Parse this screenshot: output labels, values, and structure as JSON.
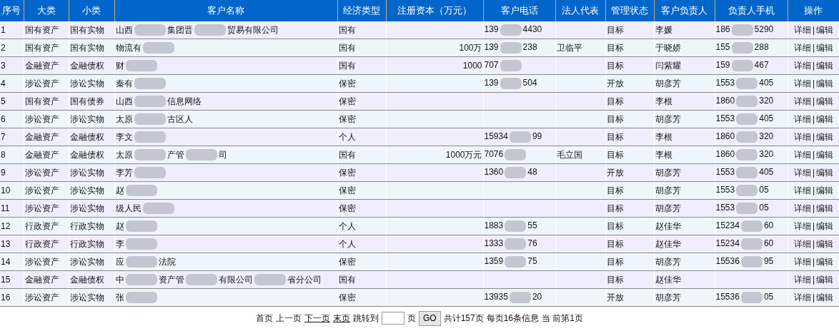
{
  "table": {
    "columns": [
      "序号",
      "大类",
      "小类",
      "客户名称",
      "经济类型",
      "注册资本（万元）",
      "客户电话",
      "法人代表",
      "管理状态",
      "客户负责人",
      "负责人手机",
      "操作"
    ],
    "rows": [
      {
        "no": "1",
        "category": "国有资产",
        "subcategory": "国有实物",
        "name": [
          "山西",
          "集团晋",
          "贸易有限公司"
        ],
        "economy": "国有",
        "capital": "",
        "phone": [
          "139",
          "4430"
        ],
        "legal": "",
        "status": "目标",
        "manager": "李媛",
        "manager_phone": [
          "186",
          "5290"
        ],
        "actions": [
          "详细",
          "|",
          "编辑"
        ]
      },
      {
        "no": "2",
        "category": "国有资产",
        "subcategory": "国有实物",
        "name": [
          "物流有"
        ],
        "economy": "国有",
        "capital": "100万",
        "phone": [
          "139",
          "238"
        ],
        "legal": "卫临平",
        "status": "目标",
        "manager": "于晓娇",
        "manager_phone": [
          "155",
          "288"
        ],
        "actions": [
          "详细",
          "|",
          "编辑"
        ]
      },
      {
        "no": "3",
        "category": "金融资产",
        "subcategory": "金融债权",
        "name": [
          "财"
        ],
        "economy": "国有",
        "capital": "1000",
        "phone": [
          "707"
        ],
        "legal": "",
        "status": "目标",
        "manager": "闫紫耀",
        "manager_phone": [
          "159",
          "467"
        ],
        "actions": [
          "详细",
          "|",
          "编辑"
        ]
      },
      {
        "no": "4",
        "category": "涉讼资产",
        "subcategory": "涉讼实物",
        "name": [
          "秦有"
        ],
        "economy": "保密",
        "capital": "",
        "phone": [
          "139",
          "504"
        ],
        "legal": "",
        "status": "开放",
        "manager": "胡彦芳",
        "manager_phone": [
          "1553",
          "405"
        ],
        "actions": [
          "详细",
          "|",
          "编辑"
        ]
      },
      {
        "no": "5",
        "category": "国有资产",
        "subcategory": "国有债券",
        "name": [
          "山西",
          "信息网络"
        ],
        "economy": "保密",
        "capital": "",
        "phone": [],
        "legal": "",
        "status": "目标",
        "manager": "李根",
        "manager_phone": [
          "1860",
          "320"
        ],
        "actions": [
          "详细",
          "|",
          "编辑"
        ]
      },
      {
        "no": "6",
        "category": "涉讼资产",
        "subcategory": "涉讼实物",
        "name": [
          "太原",
          "古区人"
        ],
        "economy": "保密",
        "capital": "",
        "phone": [],
        "legal": "",
        "status": "目标",
        "manager": "胡彦芳",
        "manager_phone": [
          "1553",
          "405"
        ],
        "actions": [
          "详细",
          "|",
          "编辑"
        ]
      },
      {
        "no": "7",
        "category": "金融资产",
        "subcategory": "金融债权",
        "name": [
          "李文"
        ],
        "economy": "个人",
        "capital": "",
        "phone": [
          "15934",
          "99"
        ],
        "legal": "",
        "status": "目标",
        "manager": "李根",
        "manager_phone": [
          "1860",
          "320"
        ],
        "actions": [
          "详细",
          "|",
          "编辑"
        ]
      },
      {
        "no": "8",
        "category": "金融资产",
        "subcategory": "金融债权",
        "name": [
          "太原",
          "产管",
          "司"
        ],
        "economy": "国有",
        "capital": "1000万元",
        "phone": [
          "7076"
        ],
        "legal": "毛立国",
        "status": "目标",
        "manager": "李根",
        "manager_phone": [
          "1860",
          "320"
        ],
        "actions": [
          "详细",
          "|",
          "编辑"
        ]
      },
      {
        "no": "9",
        "category": "涉讼资产",
        "subcategory": "涉讼实物",
        "name": [
          "李芳"
        ],
        "economy": "保密",
        "capital": "",
        "phone": [
          "1360",
          "48"
        ],
        "legal": "",
        "status": "开放",
        "manager": "胡彦芳",
        "manager_phone": [
          "1553",
          "405"
        ],
        "actions": [
          "详细",
          "|",
          "编辑"
        ]
      },
      {
        "no": "10",
        "category": "涉讼资产",
        "subcategory": "涉讼实物",
        "name": [
          "赵"
        ],
        "economy": "保密",
        "capital": "",
        "phone": [],
        "legal": "",
        "status": "目标",
        "manager": "胡彦芳",
        "manager_phone": [
          "1553",
          "05"
        ],
        "actions": [
          "详细",
          "|",
          "编辑"
        ]
      },
      {
        "no": "11",
        "category": "涉讼资产",
        "subcategory": "涉讼实物",
        "name": [
          "级人民"
        ],
        "economy": "保密",
        "capital": "",
        "phone": [],
        "legal": "",
        "status": "目标",
        "manager": "胡彦芳",
        "manager_phone": [
          "1553",
          "05"
        ],
        "actions": [
          "详细",
          "|",
          "编辑"
        ]
      },
      {
        "no": "12",
        "category": "行政资产",
        "subcategory": "行政实物",
        "name": [
          "赵"
        ],
        "economy": "个人",
        "capital": "",
        "phone": [
          "1883",
          "55"
        ],
        "legal": "",
        "status": "目标",
        "manager": "赵佳华",
        "manager_phone": [
          "15234",
          "60"
        ],
        "actions": [
          "详细",
          "|",
          "编辑"
        ]
      },
      {
        "no": "13",
        "category": "行政资产",
        "subcategory": "行政实物",
        "name": [
          "李"
        ],
        "economy": "个人",
        "capital": "",
        "phone": [
          "1333",
          "76"
        ],
        "legal": "",
        "status": "目标",
        "manager": "赵佳华",
        "manager_phone": [
          "15234",
          "60"
        ],
        "actions": [
          "详细",
          "|",
          "编辑"
        ]
      },
      {
        "no": "14",
        "category": "涉讼资产",
        "subcategory": "涉讼实物",
        "name": [
          "应",
          "法院"
        ],
        "economy": "保密",
        "capital": "",
        "phone": [
          "1359",
          "75"
        ],
        "legal": "",
        "status": "目标",
        "manager": "胡彦芳",
        "manager_phone": [
          "15536",
          "95"
        ],
        "actions": [
          "详细",
          "|",
          "编辑"
        ]
      },
      {
        "no": "15",
        "category": "金融资产",
        "subcategory": "金融债权",
        "name": [
          "中",
          "资产管",
          "有限公司",
          "省分公司"
        ],
        "economy": "国有",
        "capital": "",
        "phone": [],
        "legal": "",
        "status": "目标",
        "manager": "赵佳华",
        "manager_phone": [],
        "actions": [
          "详细",
          "|",
          "编辑"
        ]
      },
      {
        "no": "16",
        "category": "涉讼资产",
        "subcategory": "涉讼实物",
        "name": [
          "张"
        ],
        "economy": "保密",
        "capital": "",
        "phone": [
          "13935",
          "20"
        ],
        "legal": "",
        "status": "开放",
        "manager": "胡彦芳",
        "manager_phone": [
          "15536",
          "05"
        ],
        "actions": [
          "详细",
          "|",
          "编辑"
        ]
      }
    ]
  },
  "pager": {
    "links": [
      {
        "label": "首页",
        "enabled": false
      },
      {
        "label": "上一页",
        "enabled": false
      },
      {
        "label": "下一页",
        "enabled": true
      },
      {
        "label": "末页",
        "enabled": true
      }
    ],
    "jump_label": "跳转到",
    "page_unit": "页",
    "go_button": "GO",
    "total": "共计157页",
    "per_page": "每页16条信息",
    "current": "当 前第1页"
  }
}
